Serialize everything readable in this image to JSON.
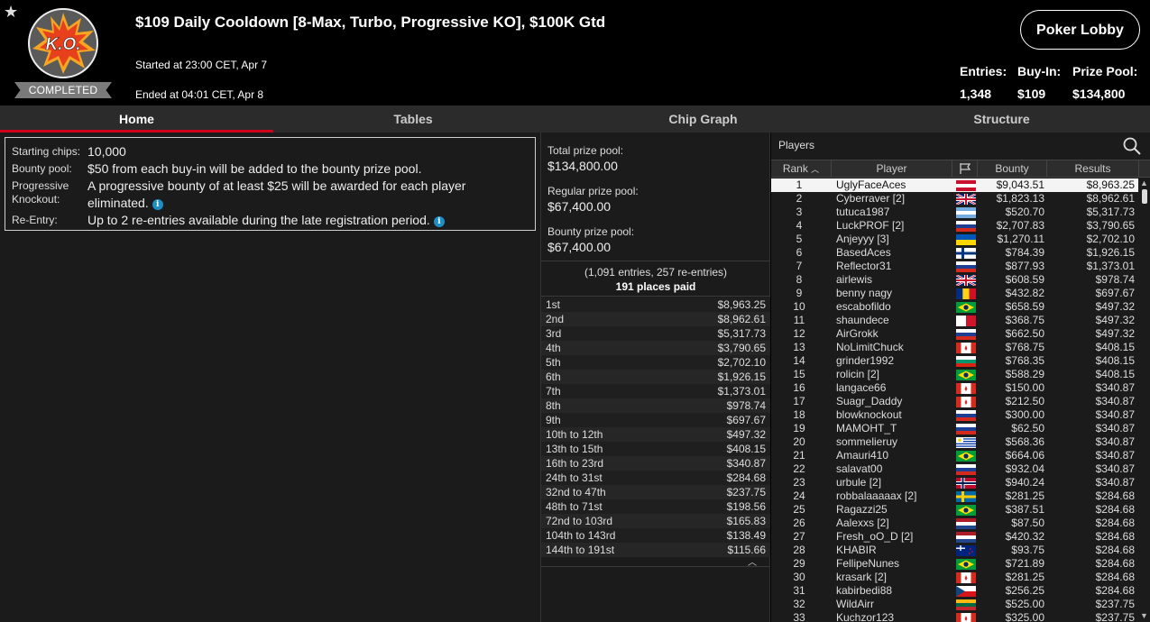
{
  "header": {
    "title": "$109 Daily Cooldown [8-Max, Turbo, Progressive KO], $100K Gtd",
    "started": "Started at 23:00 CET, Apr 7",
    "ended": "Ended at 04:01 CET, Apr 8",
    "status": "COMPLETED",
    "logo_text": "K.O.",
    "lobby_button": "Poker Lobby",
    "stats": [
      {
        "label": "Entries:",
        "value": "1,348"
      },
      {
        "label": "Buy-In:",
        "value": "$109"
      },
      {
        "label": "Prize Pool:",
        "value": "$134,800"
      }
    ]
  },
  "tabs": [
    "Home",
    "Tables",
    "Chip Graph",
    "Structure"
  ],
  "info": {
    "starting_chips_label": "Starting chips:",
    "starting_chips": "10,000",
    "bounty_pool_label": "Bounty pool:",
    "bounty_pool": "$50 from each buy-in will be added to the bounty prize pool.",
    "pko_label_1": "Progressive",
    "pko_label_2": "Knockout:",
    "pko": "A progressive bounty of at least $25 will be awarded for each player eliminated.",
    "reentry_label": "Re-Entry:",
    "reentry": "Up to 2 re-entries available during the late registration period."
  },
  "pools": {
    "total_label": "Total prize pool:",
    "total": "$134,800.00",
    "regular_label": "Regular prize pool:",
    "regular": "$67,400.00",
    "bounty_label": "Bounty prize pool:",
    "bounty": "$67,400.00",
    "entries_line": "(1,091 entries, 257 re-entries)",
    "places_line": "191 places paid"
  },
  "payouts": [
    [
      "1st",
      "$8,963.25"
    ],
    [
      "2nd",
      "$8,962.61"
    ],
    [
      "3rd",
      "$5,317.73"
    ],
    [
      "4th",
      "$3,790.65"
    ],
    [
      "5th",
      "$2,702.10"
    ],
    [
      "6th",
      "$1,926.15"
    ],
    [
      "7th",
      "$1,373.01"
    ],
    [
      "8th",
      "$978.74"
    ],
    [
      "9th",
      "$697.67"
    ],
    [
      "10th to 12th",
      "$497.32"
    ],
    [
      "13th to 15th",
      "$408.15"
    ],
    [
      "16th to 23rd",
      "$340.87"
    ],
    [
      "24th to 31st",
      "$284.68"
    ],
    [
      "32nd to 47th",
      "$237.75"
    ],
    [
      "48th to 71st",
      "$198.56"
    ],
    [
      "72nd to 103rd",
      "$165.83"
    ],
    [
      "104th to 143rd",
      "$138.49"
    ],
    [
      "144th to 191st",
      "$115.66"
    ]
  ],
  "players": {
    "title": "Players",
    "columns": {
      "rank": "Rank",
      "player": "Player",
      "bounty": "Bounty",
      "results": "Results"
    },
    "rows": [
      [
        "1",
        "UglyFaceAces",
        "$9,043.51",
        "$8,963.25",
        "at"
      ],
      [
        "2",
        "Cyberraver [2]",
        "$1,823.13",
        "$8,962.61",
        "gb"
      ],
      [
        "3",
        "tutuca1987",
        "$520.70",
        "$5,317.73",
        "ar"
      ],
      [
        "4",
        "LuckPROF [2]",
        "$2,707.83",
        "$3,790.65",
        "ru"
      ],
      [
        "5",
        "Anjeyyy [3]",
        "$1,270.11",
        "$2,702.10",
        "ua"
      ],
      [
        "6",
        "BasedAces",
        "$784.39",
        "$1,926.15",
        "fi"
      ],
      [
        "7",
        "Reflector31",
        "$877.93",
        "$1,373.01",
        "ru"
      ],
      [
        "8",
        "airlewis",
        "$608.59",
        "$978.74",
        "gb"
      ],
      [
        "9",
        "benny nagy",
        "$432.82",
        "$697.67",
        "ro"
      ],
      [
        "10",
        "escabofildo",
        "$658.59",
        "$497.32",
        "br"
      ],
      [
        "11",
        "shaundece",
        "$368.75",
        "$497.32",
        "mt"
      ],
      [
        "12",
        "AirGrokk",
        "$662.50",
        "$497.32",
        "ru"
      ],
      [
        "13",
        "NoLimitChuck",
        "$768.75",
        "$408.15",
        "ca"
      ],
      [
        "14",
        "grinder1992",
        "$768.35",
        "$408.15",
        "bg"
      ],
      [
        "15",
        "rolicin [2]",
        "$588.29",
        "$408.15",
        "br"
      ],
      [
        "16",
        "langace66",
        "$150.00",
        "$340.87",
        "ca"
      ],
      [
        "17",
        "Suagr_Daddy",
        "$212.50",
        "$340.87",
        "ca"
      ],
      [
        "18",
        "blowknockout",
        "$300.00",
        "$340.87",
        "ru"
      ],
      [
        "19",
        "MAMOHT_T",
        "$62.50",
        "$340.87",
        "ru"
      ],
      [
        "20",
        "sommelieruy",
        "$568.36",
        "$340.87",
        "uy"
      ],
      [
        "21",
        "Amauri410",
        "$664.06",
        "$340.87",
        "br"
      ],
      [
        "22",
        "salavat00",
        "$932.04",
        "$340.87",
        "ru"
      ],
      [
        "23",
        "urbule [2]",
        "$940.24",
        "$340.87",
        "no"
      ],
      [
        "24",
        "robbalaaaaax [2]",
        "$281.25",
        "$284.68",
        "se"
      ],
      [
        "25",
        "Ragazzi25",
        "$387.51",
        "$284.68",
        "br"
      ],
      [
        "26",
        "Aalexxs [2]",
        "$87.50",
        "$284.68",
        "nl"
      ],
      [
        "27",
        "Fresh_oO_D [2]",
        "$420.32",
        "$284.68",
        "nl"
      ],
      [
        "28",
        "KHABIR",
        "$93.75",
        "$284.68",
        "nz"
      ],
      [
        "29",
        "FellipeNunes",
        "$721.89",
        "$284.68",
        "br"
      ],
      [
        "30",
        "krasark [2]",
        "$281.25",
        "$284.68",
        "ca"
      ],
      [
        "31",
        "kabirbedi88",
        "$256.25",
        "$284.68",
        "cz"
      ],
      [
        "32",
        "WildAirr",
        "$525.00",
        "$237.75",
        "lt"
      ],
      [
        "33",
        "Kuchzor123",
        "$325.00",
        "$237.75",
        "ca"
      ]
    ]
  }
}
